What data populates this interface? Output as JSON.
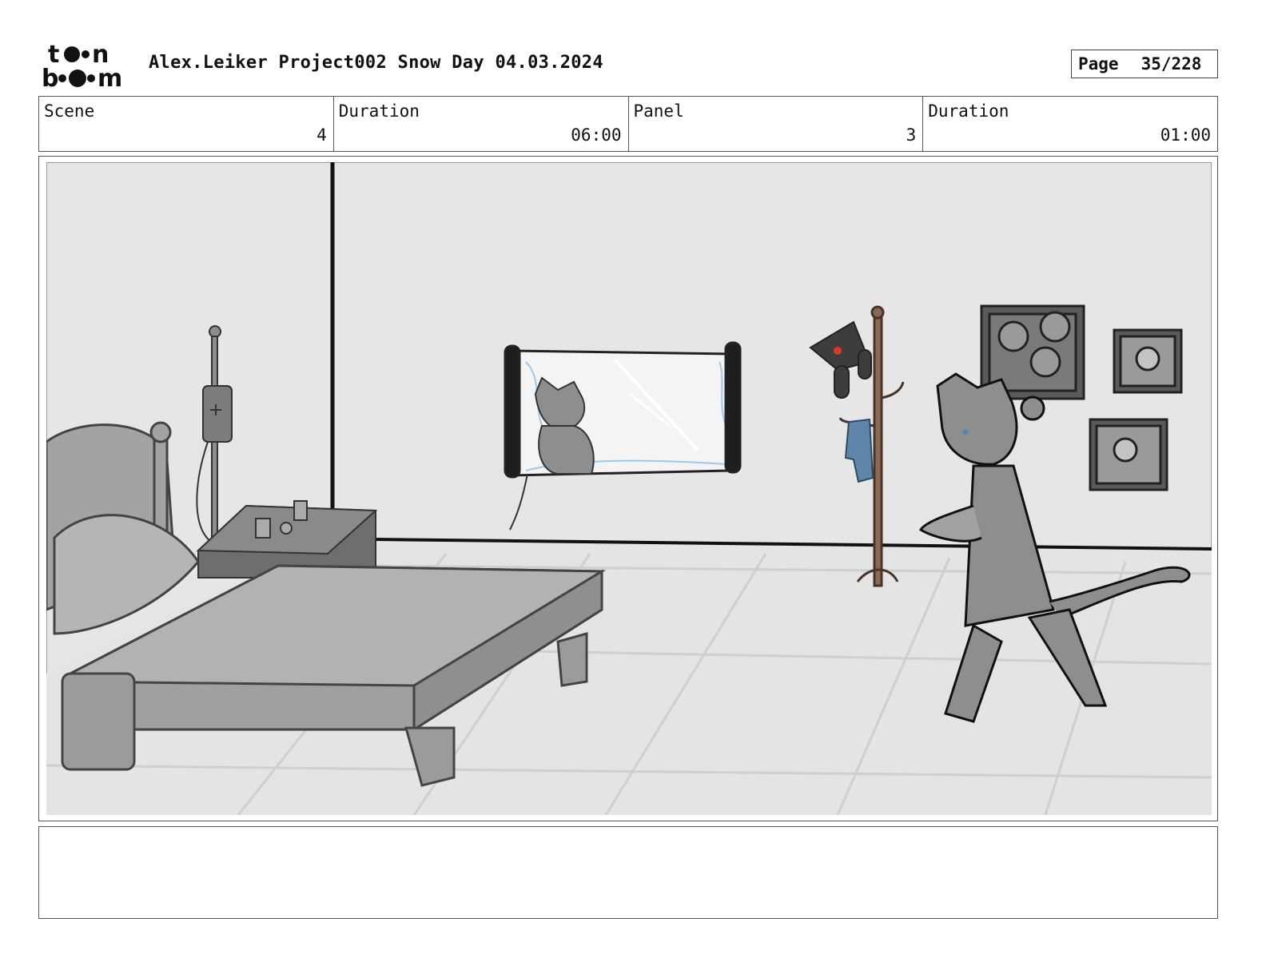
{
  "header": {
    "logo_text": "toon boom",
    "title": "Alex.Leiker Project002 Snow Day 04.03.2024",
    "page_label": "Page",
    "page_number": "35/228"
  },
  "info": {
    "scene_label": "Scene",
    "scene_value": "4",
    "scene_duration_label": "Duration",
    "scene_duration_value": "06:00",
    "panel_label": "Panel",
    "panel_value": "3",
    "panel_duration_label": "Duration",
    "panel_duration_value": "01:00"
  },
  "caption": {
    "text": ""
  },
  "colors": {
    "frame": "#555555",
    "wall": "#e6e6e6",
    "coat_rack": "#8a6a55",
    "scarf": "#5f86a8",
    "accent_red": "#d83a2a"
  }
}
